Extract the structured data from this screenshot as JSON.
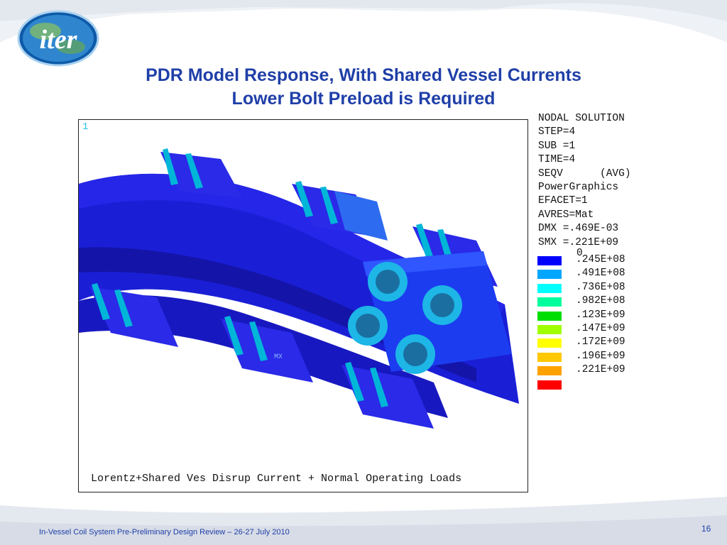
{
  "slide": {
    "title_line1": "PDR Model Response, With Shared Vessel Currents",
    "title_line2": "Lower Bolt Preload is Required",
    "logo_text": "iter",
    "footer": "In-Vessel Coil System Pre-Preliminary Design Review – 26-27 July 2010",
    "page_number": "16"
  },
  "plot": {
    "window_number": "1",
    "caption": "Lorentz+Shared Ves Disrup Current + Normal Operating Loads",
    "mx_label": "MX",
    "info_lines": [
      "NODAL SOLUTION",
      "STEP=4",
      "SUB =1",
      "TIME=4",
      "SEQV      (AVG)",
      "PowerGraphics",
      "EFACET=1",
      "AVRES=Mat",
      "DMX =.469E-03",
      "SMX =.221E+09"
    ],
    "legend_zero": "0",
    "legend": [
      {
        "color": "#0000ff",
        "label": ".245E+08"
      },
      {
        "color": "#00a6ff",
        "label": ".491E+08"
      },
      {
        "color": "#00ffff",
        "label": ".736E+08"
      },
      {
        "color": "#00ff9c",
        "label": ".982E+08"
      },
      {
        "color": "#00dd00",
        "label": ".123E+09"
      },
      {
        "color": "#a0ff00",
        "label": ".147E+09"
      },
      {
        "color": "#ffff00",
        "label": ".172E+09"
      },
      {
        "color": "#ffc800",
        "label": ".196E+09"
      },
      {
        "color": "#ffa200",
        "label": ".221E+09"
      },
      {
        "color": "#ff0000",
        "label": ""
      }
    ]
  }
}
